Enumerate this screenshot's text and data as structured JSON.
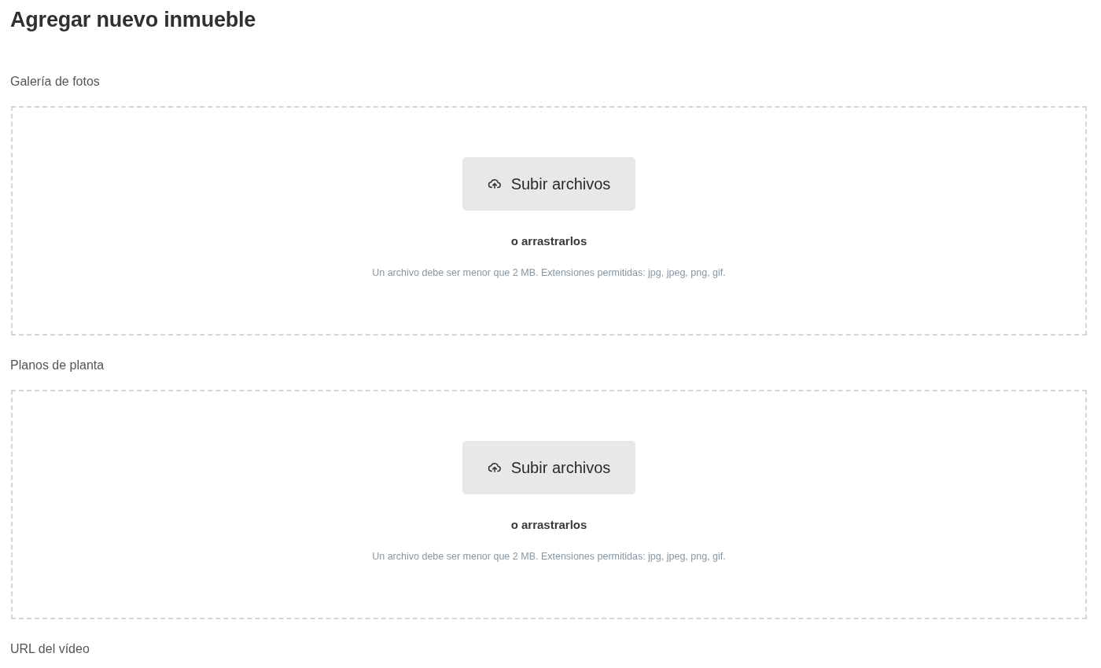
{
  "title": "Agregar nuevo inmueble",
  "fields": [
    {
      "kind": "upload",
      "label": "Galería de fotos",
      "button": "Subir archivos",
      "drag_text": "o arrastrarlos",
      "hint": "Un archivo debe ser menor que 2 MB. Extensiones permitidas: jpg, jpeg, png, gif."
    },
    {
      "kind": "upload",
      "label": "Planos de planta",
      "button": "Subir archivos",
      "drag_text": "o arrastrarlos",
      "hint": "Un archivo debe ser menor que 2 MB. Extensiones permitidas: jpg, jpeg, png, gif."
    },
    {
      "kind": "label",
      "label": "URL del vídeo"
    }
  ]
}
